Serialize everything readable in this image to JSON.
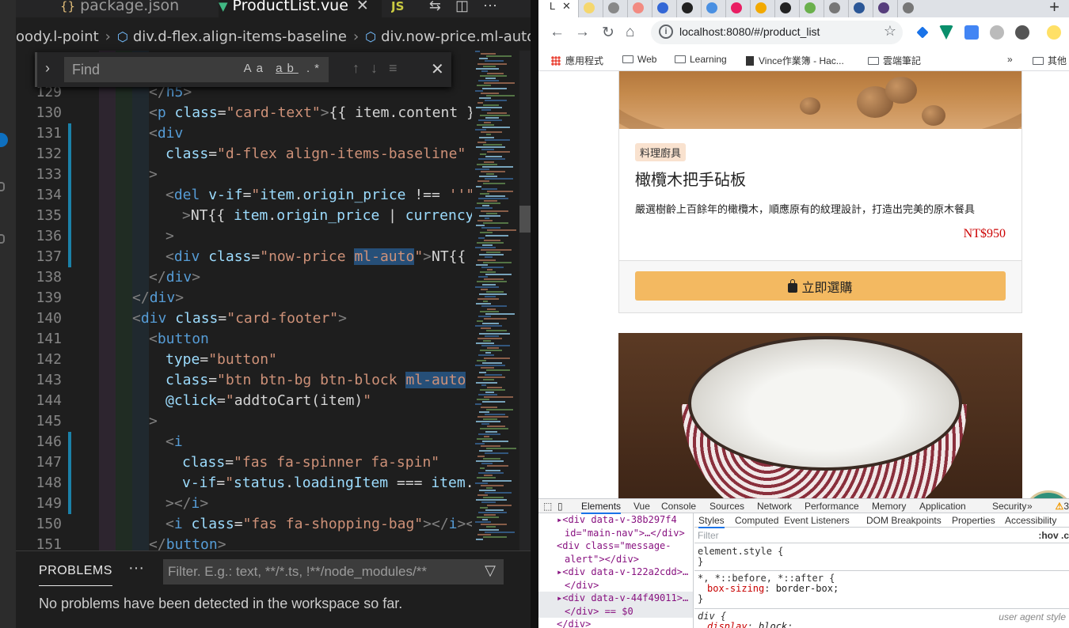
{
  "vscode": {
    "tabs": [
      {
        "icon": "{}",
        "label": "package.json",
        "active": false
      },
      {
        "icon": "▼",
        "label": "ProductList.vue",
        "active": true
      },
      {
        "icon": "JS",
        "label": "",
        "active": false
      }
    ],
    "breadcrumb": [
      "oody.l-point",
      "div.d-flex.align-items-baseline",
      "div.now-price.ml-auto"
    ],
    "find": {
      "placeholder": "Find",
      "options": "Aa ab .*"
    },
    "lines": [
      {
        "n": "129",
        "html": "<span class='pu'>&lt;/</span><span class='tg'>h5</span><span class='pu'>&gt;</span>",
        "indent": 168
      },
      {
        "n": "130",
        "html": "<span class='pu'>&lt;</span><span class='tg'>p</span> <span class='at'>class</span><span class='tx'>=</span><span class='st'>\"card-text\"</span><span class='pu'>&gt;</span><span class='tx'>{{ item.content }}</span>",
        "indent": 168
      },
      {
        "n": "131",
        "html": "<span class='pu'>&lt;</span><span class='tg'>div</span>",
        "indent": 168
      },
      {
        "n": "132",
        "html": "<span class='at'>class</span><span class='tx'>=</span><span class='st'>\"d-flex align-items-baseline\"</span>",
        "indent": 189
      },
      {
        "n": "133",
        "html": "<span class='pu'>&gt;</span>",
        "indent": 168
      },
      {
        "n": "134",
        "html": "<span class='pu'>&lt;</span><span class='tg'>del</span> <span class='at'>v-if</span><span class='tx'>=</span><span class='st'>\"</span><span class='at'>item</span><span class='tx'>.</span><span class='at'>origin_price</span> <span class='tx'>!==</span> <span class='st'>''\"</span>",
        "indent": 189
      },
      {
        "n": "135",
        "html": "<span class='pu'>&gt;</span><span class='tx'>NT{{ </span><span class='at'>item</span><span class='tx'>.</span><span class='at'>origin_price</span><span class='tx'> | </span><span class='at'>currency</span>",
        "indent": 210
      },
      {
        "n": "136",
        "html": "<span class='pu'>&gt;</span>",
        "indent": 189
      },
      {
        "n": "137",
        "html": "<span class='pu'>&lt;</span><span class='tg'>div</span> <span class='at'>class</span><span class='tx'>=</span><span class='st'>\"now-price <span class='hl'>ml-auto</span>\"</span><span class='pu'>&gt;</span><span class='tx'>NT{{ i</span>",
        "indent": 189
      },
      {
        "n": "138",
        "html": "<span class='pu'>&lt;/</span><span class='tg'>div</span><span class='pu'>&gt;</span>",
        "indent": 168
      },
      {
        "n": "139",
        "html": "<span class='pu'>&lt;/</span><span class='tg'>div</span><span class='pu'>&gt;</span>",
        "indent": 147
      },
      {
        "n": "140",
        "html": "<span class='pu'>&lt;</span><span class='tg'>div</span> <span class='at'>class</span><span class='tx'>=</span><span class='st'>\"card-footer\"</span><span class='pu'>&gt;</span>",
        "indent": 147
      },
      {
        "n": "141",
        "html": "<span class='pu'>&lt;</span><span class='tg'>button</span>",
        "indent": 168
      },
      {
        "n": "142",
        "html": "<span class='at'>type</span><span class='tx'>=</span><span class='st'>\"button\"</span>",
        "indent": 189
      },
      {
        "n": "143",
        "html": "<span class='at'>class</span><span class='tx'>=</span><span class='st'>\"btn btn-bg btn-block <span class='hl'>ml-auto</span> t</span>",
        "indent": 189
      },
      {
        "n": "144",
        "html": "<span class='at'>@click</span><span class='tx'>=</span><span class='st'>\"</span><span class='tx'>addtoCart(item)</span><span class='st'>\"</span>",
        "indent": 189
      },
      {
        "n": "145",
        "html": "<span class='pu'>&gt;</span>",
        "indent": 168
      },
      {
        "n": "146",
        "html": "<span class='pu'>&lt;</span><span class='tg'>i</span>",
        "indent": 189
      },
      {
        "n": "147",
        "html": "<span class='at'>class</span><span class='tx'>=</span><span class='st'>\"fas fa-spinner fa-spin\"</span>",
        "indent": 210
      },
      {
        "n": "148",
        "html": "<span class='at'>v-if</span><span class='tx'>=</span><span class='st'>\"</span><span class='at'>status</span><span class='tx'>.</span><span class='at'>loadingItem</span><span class='tx'> === </span><span class='at'>item</span><span class='tx'>.i</span>",
        "indent": 210
      },
      {
        "n": "149",
        "html": "<span class='pu'>&gt;&lt;/</span><span class='tg'>i</span><span class='pu'>&gt;</span>",
        "indent": 189
      },
      {
        "n": "150",
        "html": "<span class='pu'>&lt;</span><span class='tg'>i</span> <span class='at'>class</span><span class='tx'>=</span><span class='st'>\"fas fa-shopping-bag\"</span><span class='pu'>&gt;&lt;/</span><span class='tg'>i</span><span class='pu'>&gt;&lt;s</span>",
        "indent": 189
      },
      {
        "n": "151",
        "html": "<span class='pu'>&lt;/</span><span class='tg'>button</span><span class='pu'>&gt;</span>",
        "indent": 168
      }
    ],
    "panel": {
      "title": "PROBLEMS",
      "more": "···",
      "filter_placeholder": "Filter. E.g.: text, **/*.ts, !**/node_modules/**",
      "message": "No problems have been detected in the workspace so far."
    }
  },
  "chrome": {
    "active_tab": {
      "title": "L",
      "close": "✕"
    },
    "url": "localhost:8080/#/product_list",
    "bookmarks": [
      "應用程式",
      "Web",
      "Learning",
      "Vince作業簿 - Hac...",
      "雲端筆記",
      "»",
      "其他"
    ],
    "product1": {
      "category": "料理廚具",
      "title": "橄欖木把手砧板",
      "description": "嚴選樹齡上百餘年的橄欖木，順應原有的紋理設計，打造出完美的原木餐具",
      "price": "NT$950",
      "button": "立即選購"
    },
    "devtools": {
      "tabs": [
        "Elements",
        "Vue",
        "Console",
        "Sources",
        "Network",
        "Performance",
        "Memory",
        "Application",
        "Security",
        "»"
      ],
      "warnings": "3",
      "style_tabs": [
        "Styles",
        "Computed",
        "Event Listeners",
        "DOM Breakpoints",
        "Properties",
        "Accessibility"
      ],
      "filter_placeholder": "Filter",
      "hov": ":hov .c",
      "elements": [
        {
          "text": "▸<div data-v-38b297f4 id=\"main-nav\">…</div>",
          "sel": false
        },
        {
          "text": "<div class=\"message-alert\"></div>",
          "sel": false
        },
        {
          "text": "▸<div data-v-122a2cdd>…</div>",
          "sel": false
        },
        {
          "text": "▸<div data-v-44f49011>…</div> == $0",
          "sel": true
        },
        {
          "text": "</div>",
          "sel": false
        }
      ],
      "rules": [
        {
          "selector": "element.style {",
          "body": "}"
        },
        {
          "selector": "*, *::before, *::after {",
          "prop": "box-sizing",
          "val": "border-box;",
          "body": "}"
        },
        {
          "selector": "div {",
          "prop": "display",
          "val": "block;",
          "source": "user agent style"
        }
      ]
    }
  }
}
